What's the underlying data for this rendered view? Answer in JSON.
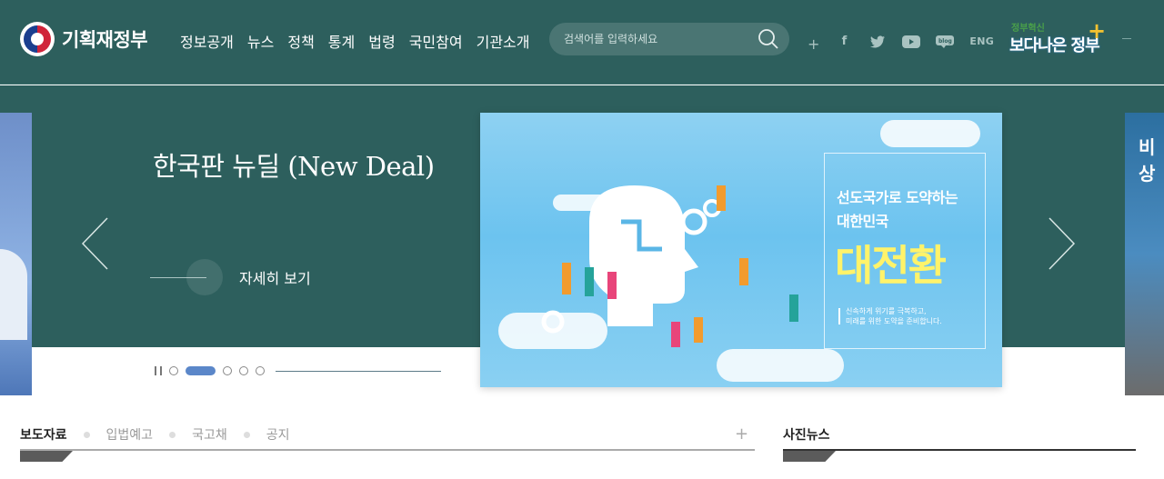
{
  "header": {
    "logo_text": "기획재정부",
    "nav": [
      "정보공개",
      "뉴스",
      "정책",
      "통계",
      "법령",
      "국민참여",
      "기관소개"
    ],
    "search_placeholder": "검색어를 입력하세요",
    "plus": "+",
    "sns": {
      "facebook": "f",
      "twitter": "t",
      "youtube": "▶",
      "blog": "blog",
      "eng": "ENG"
    },
    "brand": {
      "small": "정부혁신",
      "big": "보다나은 정부",
      "cross": "+"
    }
  },
  "hero": {
    "title": "한국판 뉴딜 (New Deal)",
    "more_label": "자세히 보기",
    "side_right_text": "비상",
    "banner": {
      "line1": "선도국가로 도약하는",
      "line2": "대한민국",
      "line3": "대전환",
      "sub1": "신속하게 위기를 극복하고,",
      "sub2": "미래를 위한 도약을 준비합니다."
    }
  },
  "tabs": [
    "보도자료",
    "입법예고",
    "국고채",
    "공지"
  ],
  "tabs_plus": "+",
  "photo_news": "사진뉴스",
  "colors": {
    "header_bg": "#2d5f5d",
    "accent": "#5b87c9",
    "highlight": "#fff36a"
  }
}
